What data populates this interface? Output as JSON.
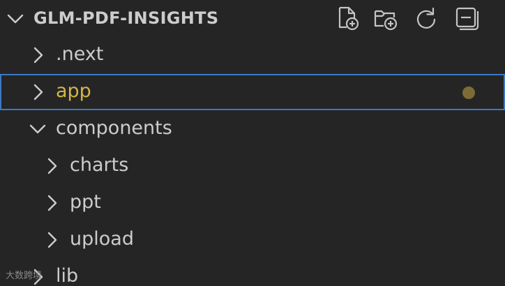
{
  "explorer": {
    "title": "GLM-PDF-INSIGHTS",
    "actions": [
      {
        "name": "new-file",
        "label": "New File"
      },
      {
        "name": "new-folder",
        "label": "New Folder"
      },
      {
        "name": "refresh",
        "label": "Refresh Explorer"
      },
      {
        "name": "collapse",
        "label": "Collapse Folders in Explorer"
      }
    ],
    "items": [
      {
        "label": ".next",
        "expanded": false,
        "depth": 0
      },
      {
        "label": "app",
        "expanded": false,
        "depth": 0,
        "selected": true,
        "modified": true
      },
      {
        "label": "components",
        "expanded": true,
        "depth": 0
      },
      {
        "label": "charts",
        "expanded": false,
        "depth": 1
      },
      {
        "label": "ppt",
        "expanded": false,
        "depth": 1
      },
      {
        "label": "upload",
        "expanded": false,
        "depth": 1
      },
      {
        "label": "lib",
        "expanded": false,
        "depth": 0
      }
    ]
  },
  "colors": {
    "background": "#252526",
    "text": "#cccccc",
    "modified_text": "#d4b646",
    "selection_border": "#3c79c4",
    "modified_dot": "#7c6b36"
  },
  "watermark": "大数跨境"
}
